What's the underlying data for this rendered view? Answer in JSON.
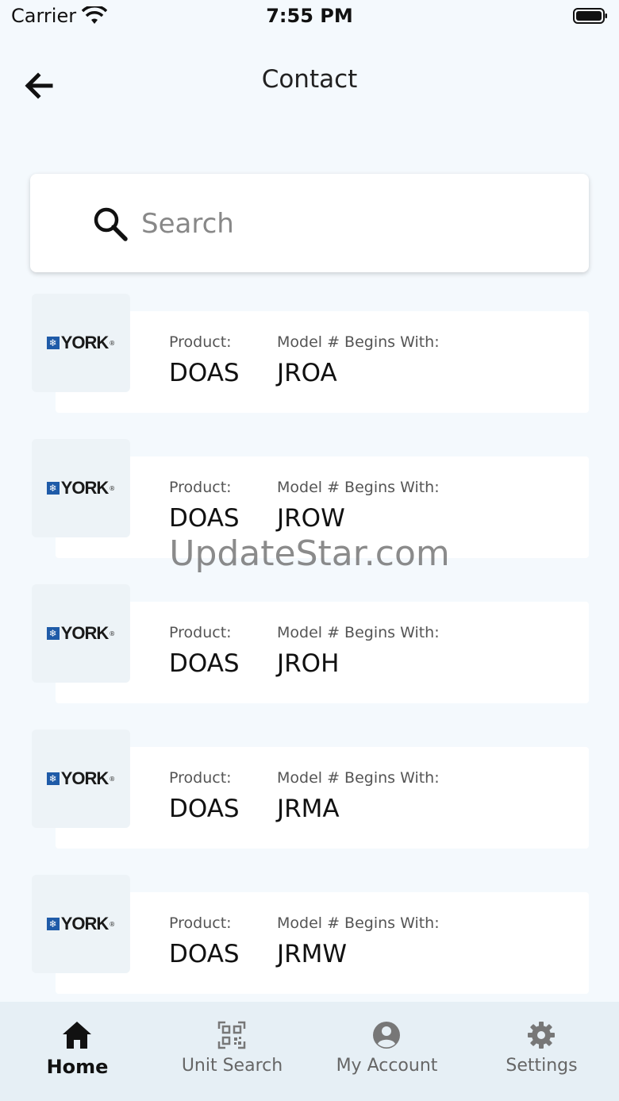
{
  "status_bar": {
    "carrier": "Carrier",
    "time": "7:55 PM"
  },
  "header": {
    "title": "Contact"
  },
  "search": {
    "placeholder": "Search"
  },
  "items": [
    {
      "brand": "YORK",
      "product_label": "Product:",
      "product": "DOAS",
      "model_label": "Model # Begins With:",
      "model": "JROA"
    },
    {
      "brand": "YORK",
      "product_label": "Product:",
      "product": "DOAS",
      "model_label": "Model # Begins With:",
      "model": "JROW"
    },
    {
      "brand": "YORK",
      "product_label": "Product:",
      "product": "DOAS",
      "model_label": "Model # Begins With:",
      "model": "JROH"
    },
    {
      "brand": "YORK",
      "product_label": "Product:",
      "product": "DOAS",
      "model_label": "Model # Begins With:",
      "model": "JRMA"
    },
    {
      "brand": "YORK",
      "product_label": "Product:",
      "product": "DOAS",
      "model_label": "Model # Begins With:",
      "model": "JRMW"
    }
  ],
  "watermark": "UpdateStar.com",
  "tabs": [
    {
      "label": "Home",
      "icon": "home-icon",
      "active": true
    },
    {
      "label": "Unit Search",
      "icon": "qr-code-icon",
      "active": false
    },
    {
      "label": "My Account",
      "icon": "account-icon",
      "active": false
    },
    {
      "label": "Settings",
      "icon": "gear-icon",
      "active": false
    }
  ],
  "colors": {
    "background": "#f4f9fd",
    "tabbar": "#e6eff5",
    "york_blue": "#1f5ba8"
  }
}
